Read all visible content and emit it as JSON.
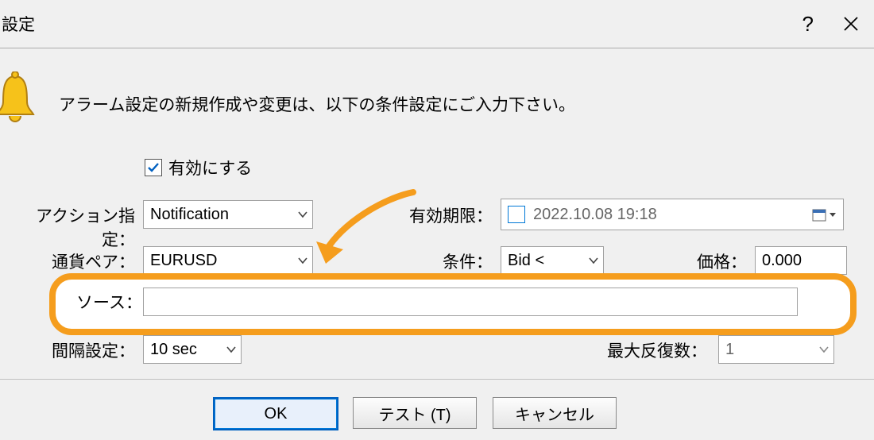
{
  "title": "設定",
  "intro": "アラーム設定の新規作成や変更は、以下の条件設定にご入力下さい。",
  "enable": {
    "label": "有効にする",
    "checked": true
  },
  "action": {
    "label": "アクション指定：",
    "value": "Notification"
  },
  "expire": {
    "label": "有効期限：",
    "value": "2022.10.08 19:18",
    "enabled": false
  },
  "symbol": {
    "label": "通貨ペア：",
    "value": "EURUSD"
  },
  "condition": {
    "label": "条件：",
    "value": "Bid <"
  },
  "price": {
    "label": "価格：",
    "value": "0.000"
  },
  "source": {
    "label": "ソース：",
    "value": ""
  },
  "interval": {
    "label": "間隔設定：",
    "value": "10 sec"
  },
  "maxiter": {
    "label": "最大反復数：",
    "value": "1"
  },
  "buttons": {
    "ok": "OK",
    "test": "テスト (T)",
    "cancel": "キャンセル"
  }
}
